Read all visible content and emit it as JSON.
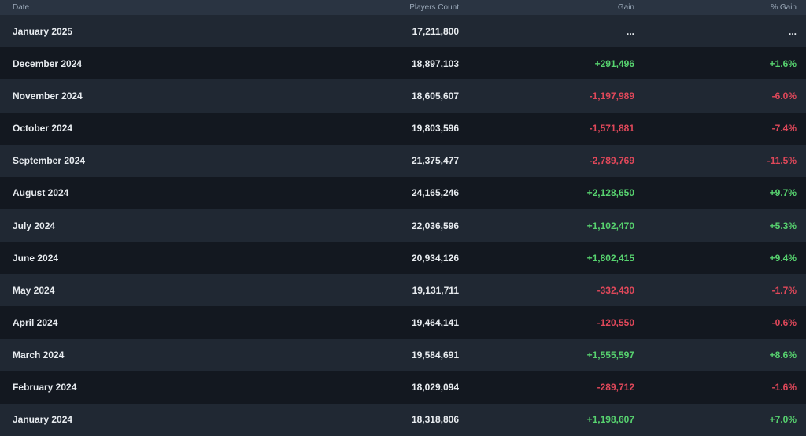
{
  "headers": {
    "date": "Date",
    "players": "Players Count",
    "gain": "Gain",
    "pct": "% Gain"
  },
  "rows": [
    {
      "date": "January 2025",
      "players": "17,211,800",
      "gain": "...",
      "pct": "...",
      "trend": "neutral"
    },
    {
      "date": "December 2024",
      "players": "18,897,103",
      "gain": "+291,496",
      "pct": "+1.6%",
      "trend": "pos"
    },
    {
      "date": "November 2024",
      "players": "18,605,607",
      "gain": "-1,197,989",
      "pct": "-6.0%",
      "trend": "neg"
    },
    {
      "date": "October 2024",
      "players": "19,803,596",
      "gain": "-1,571,881",
      "pct": "-7.4%",
      "trend": "neg"
    },
    {
      "date": "September 2024",
      "players": "21,375,477",
      "gain": "-2,789,769",
      "pct": "-11.5%",
      "trend": "neg"
    },
    {
      "date": "August 2024",
      "players": "24,165,246",
      "gain": "+2,128,650",
      "pct": "+9.7%",
      "trend": "pos"
    },
    {
      "date": "July 2024",
      "players": "22,036,596",
      "gain": "+1,102,470",
      "pct": "+5.3%",
      "trend": "pos"
    },
    {
      "date": "June 2024",
      "players": "20,934,126",
      "gain": "+1,802,415",
      "pct": "+9.4%",
      "trend": "pos"
    },
    {
      "date": "May 2024",
      "players": "19,131,711",
      "gain": "-332,430",
      "pct": "-1.7%",
      "trend": "neg"
    },
    {
      "date": "April 2024",
      "players": "19,464,141",
      "gain": "-120,550",
      "pct": "-0.6%",
      "trend": "neg"
    },
    {
      "date": "March 2024",
      "players": "19,584,691",
      "gain": "+1,555,597",
      "pct": "+8.6%",
      "trend": "pos"
    },
    {
      "date": "February 2024",
      "players": "18,029,094",
      "gain": "-289,712",
      "pct": "-1.6%",
      "trend": "neg"
    },
    {
      "date": "January 2024",
      "players": "18,318,806",
      "gain": "+1,198,607",
      "pct": "+7.0%",
      "trend": "pos"
    }
  ],
  "colors": {
    "positive": "#57d26f",
    "negative": "#e0485a",
    "header_bg": "#2a3442",
    "row_odd": "#202833",
    "row_even": "#131820"
  }
}
